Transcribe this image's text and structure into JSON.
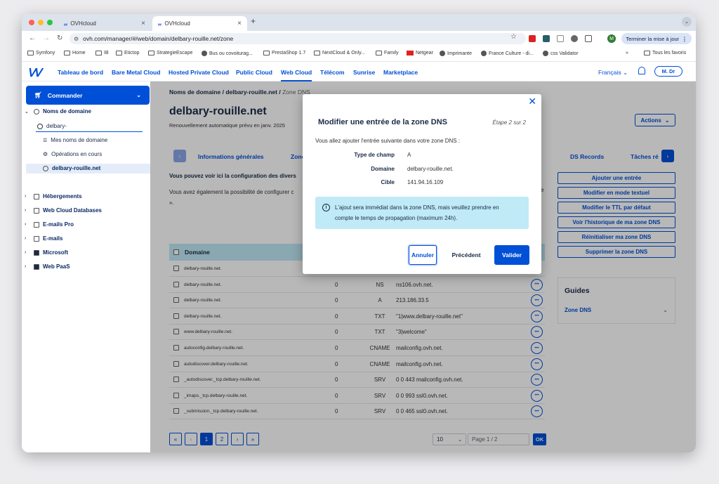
{
  "browser": {
    "tabs": [
      {
        "label": "OVHcloud"
      },
      {
        "label": "OVHcloud"
      }
    ],
    "url": "ovh.com/manager/#/web/domain/delbary-rouille.net/zone",
    "update_label": "Terminer la mise à jour",
    "profile_initial": "M",
    "bookmarks": [
      "Symfony",
      "Home",
      "IB",
      "Etictop",
      "StrategieEscape",
      "Bus ou covoiturag...",
      "PrestaShop 1.7",
      "NextCloud & Only...",
      "Family",
      "Netgear",
      "Imprimante",
      "France Culture - di...",
      "css Validator"
    ],
    "all_bookmarks": "Tous les favoris"
  },
  "topnav": {
    "items": [
      "Tableau de bord",
      "Bare Metal Cloud",
      "Hosted Private Cloud",
      "Public Cloud",
      "Web Cloud",
      "Télécom",
      "Sunrise",
      "Marketplace"
    ],
    "language": "Français",
    "user": "M. Dr"
  },
  "sidebar": {
    "order_label": "Commander",
    "domains_label": "Noms de domaine",
    "search_value": "delbary-",
    "my_domains": "Mes noms de domaine",
    "operations": "Opérations en cours",
    "selected_domain": "delbary-rouille.net",
    "sections": [
      "Hébergements",
      "Web Cloud Databases",
      "E-mails Pro",
      "E-mails",
      "Microsoft",
      "Web PaaS"
    ]
  },
  "page": {
    "breadcrumb": [
      "Noms de domaine",
      "delbary-rouille.net",
      "Zone DNS"
    ],
    "title": "delbary-rouille.net",
    "subtitle": "Renouvellement automatique prévu en janv. 2025",
    "actions_label": "Actions",
    "tabs": [
      "Informations générales",
      "Zone DNS",
      "DS Records",
      "Tâches ré"
    ],
    "info_bold": "Vous pouvez voir ici la configuration des divers",
    "info_text": "Vous avez également la possibilité de configurer c",
    "info_text2": "».",
    "info_text_end": "e"
  },
  "side_actions": [
    "Ajouter une entrée",
    "Modifier en mode textuel",
    "Modifier le TTL par défaut",
    "Voir l'historique de ma zone DNS",
    "Réinitialiser ma zone DNS",
    "Supprimer la zone DNS"
  ],
  "guides": {
    "title": "Guides",
    "item": "Zone DNS"
  },
  "table": {
    "header_domain": "Domaine",
    "rows": [
      {
        "domain": "delbary-rouille.net.",
        "ttl": "",
        "type": "",
        "target": ""
      },
      {
        "domain": "delbary-rouille.net.",
        "ttl": "0",
        "type": "NS",
        "target": "ns106.ovh.net."
      },
      {
        "domain": "delbary-rouille.net.",
        "ttl": "0",
        "type": "A",
        "target": "213.186.33.5"
      },
      {
        "domain": "delbary-rouille.net.",
        "ttl": "0",
        "type": "TXT",
        "target": "\"1|www.delbary-rouille.net\""
      },
      {
        "domain": "www.delbary-rouille.net.",
        "ttl": "0",
        "type": "TXT",
        "target": "\"3|welcome\""
      },
      {
        "domain": "autoconfig.delbary-rouille.net.",
        "ttl": "0",
        "type": "CNAME",
        "target": "mailconfig.ovh.net."
      },
      {
        "domain": "autodiscover.delbary-rouille.net.",
        "ttl": "0",
        "type": "CNAME",
        "target": "mailconfig.ovh.net."
      },
      {
        "domain": "_autodiscover._tcp.delbary-rouille.net.",
        "ttl": "0",
        "type": "SRV",
        "target": "0 0 443 mailconfig.ovh.net."
      },
      {
        "domain": "_imaps._tcp.delbary-rouille.net.",
        "ttl": "0",
        "type": "SRV",
        "target": "0 0 993 ssl0.ovh.net."
      },
      {
        "domain": "_submission._tcp.delbary-rouille.net.",
        "ttl": "0",
        "type": "SRV",
        "target": "0 0 465 ssl0.ovh.net."
      }
    ]
  },
  "pagination": {
    "pages": [
      "1",
      "2"
    ],
    "per_page": "10",
    "page_placeholder": "Page 1 / 2",
    "ok_label": "OK"
  },
  "modal": {
    "title": "Modifier une entrée de la zone DNS",
    "step": "Étape 2 sur 2",
    "intro": "Vous allez ajouter l'entrée suivante dans votre zone DNS :",
    "fields": [
      {
        "label": "Type de champ",
        "value": "A"
      },
      {
        "label": "Domaine",
        "value": "delbary-rouille.net."
      },
      {
        "label": "Cible",
        "value": "141.94.16.109"
      }
    ],
    "notice_line1": "L'ajout sera immédiat dans la zone DNS, mais veuillez prendre en",
    "notice_line2": "compte le temps de propagation (maximum 24h).",
    "cancel": "Annuler",
    "previous": "Précédent",
    "validate": "Valider"
  },
  "colors": {
    "primary": "#0050d7",
    "table_header": "#bfe9f5",
    "notice": "#bfeaf6"
  }
}
